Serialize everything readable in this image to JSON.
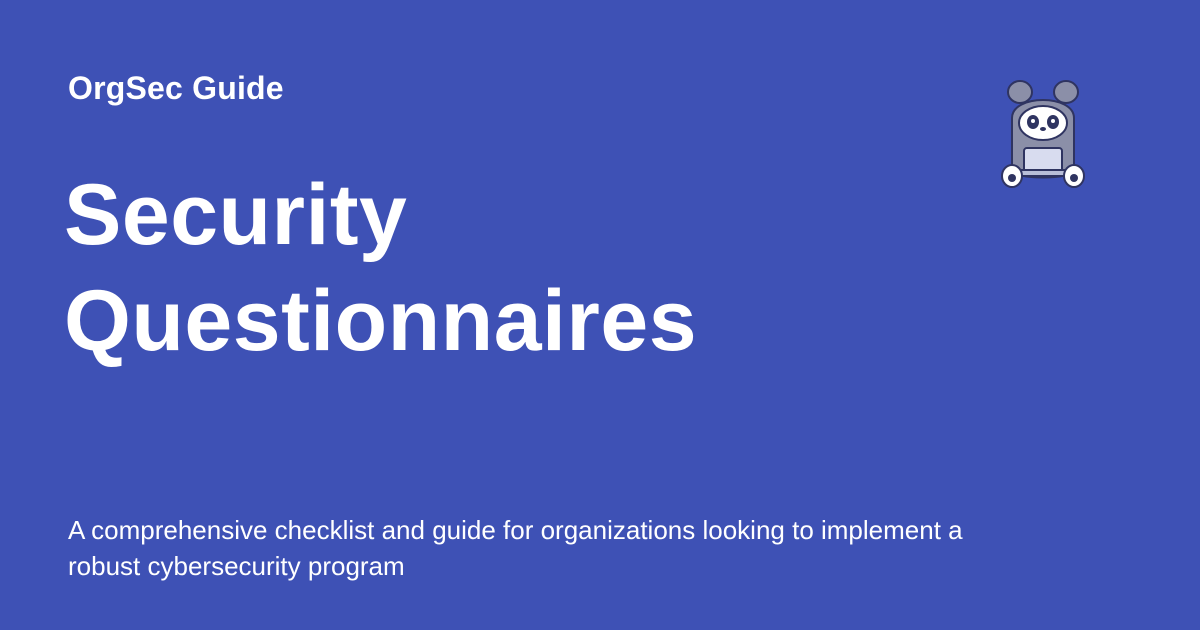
{
  "site": {
    "name": "OrgSec Guide"
  },
  "page": {
    "title_lines": [
      "Security",
      "Questionnaires"
    ],
    "description": "A comprehensive checklist and guide for organizations looking to implement a robust cybersecurity program"
  },
  "colors": {
    "background": "#3e51b5",
    "text": "#ffffff",
    "mascot_body": "#8b8fa8",
    "mascot_face": "#ffffff",
    "mascot_outline": "#2f3461"
  },
  "mascot": {
    "icon": "hooded-panda-with-laptop-icon"
  }
}
